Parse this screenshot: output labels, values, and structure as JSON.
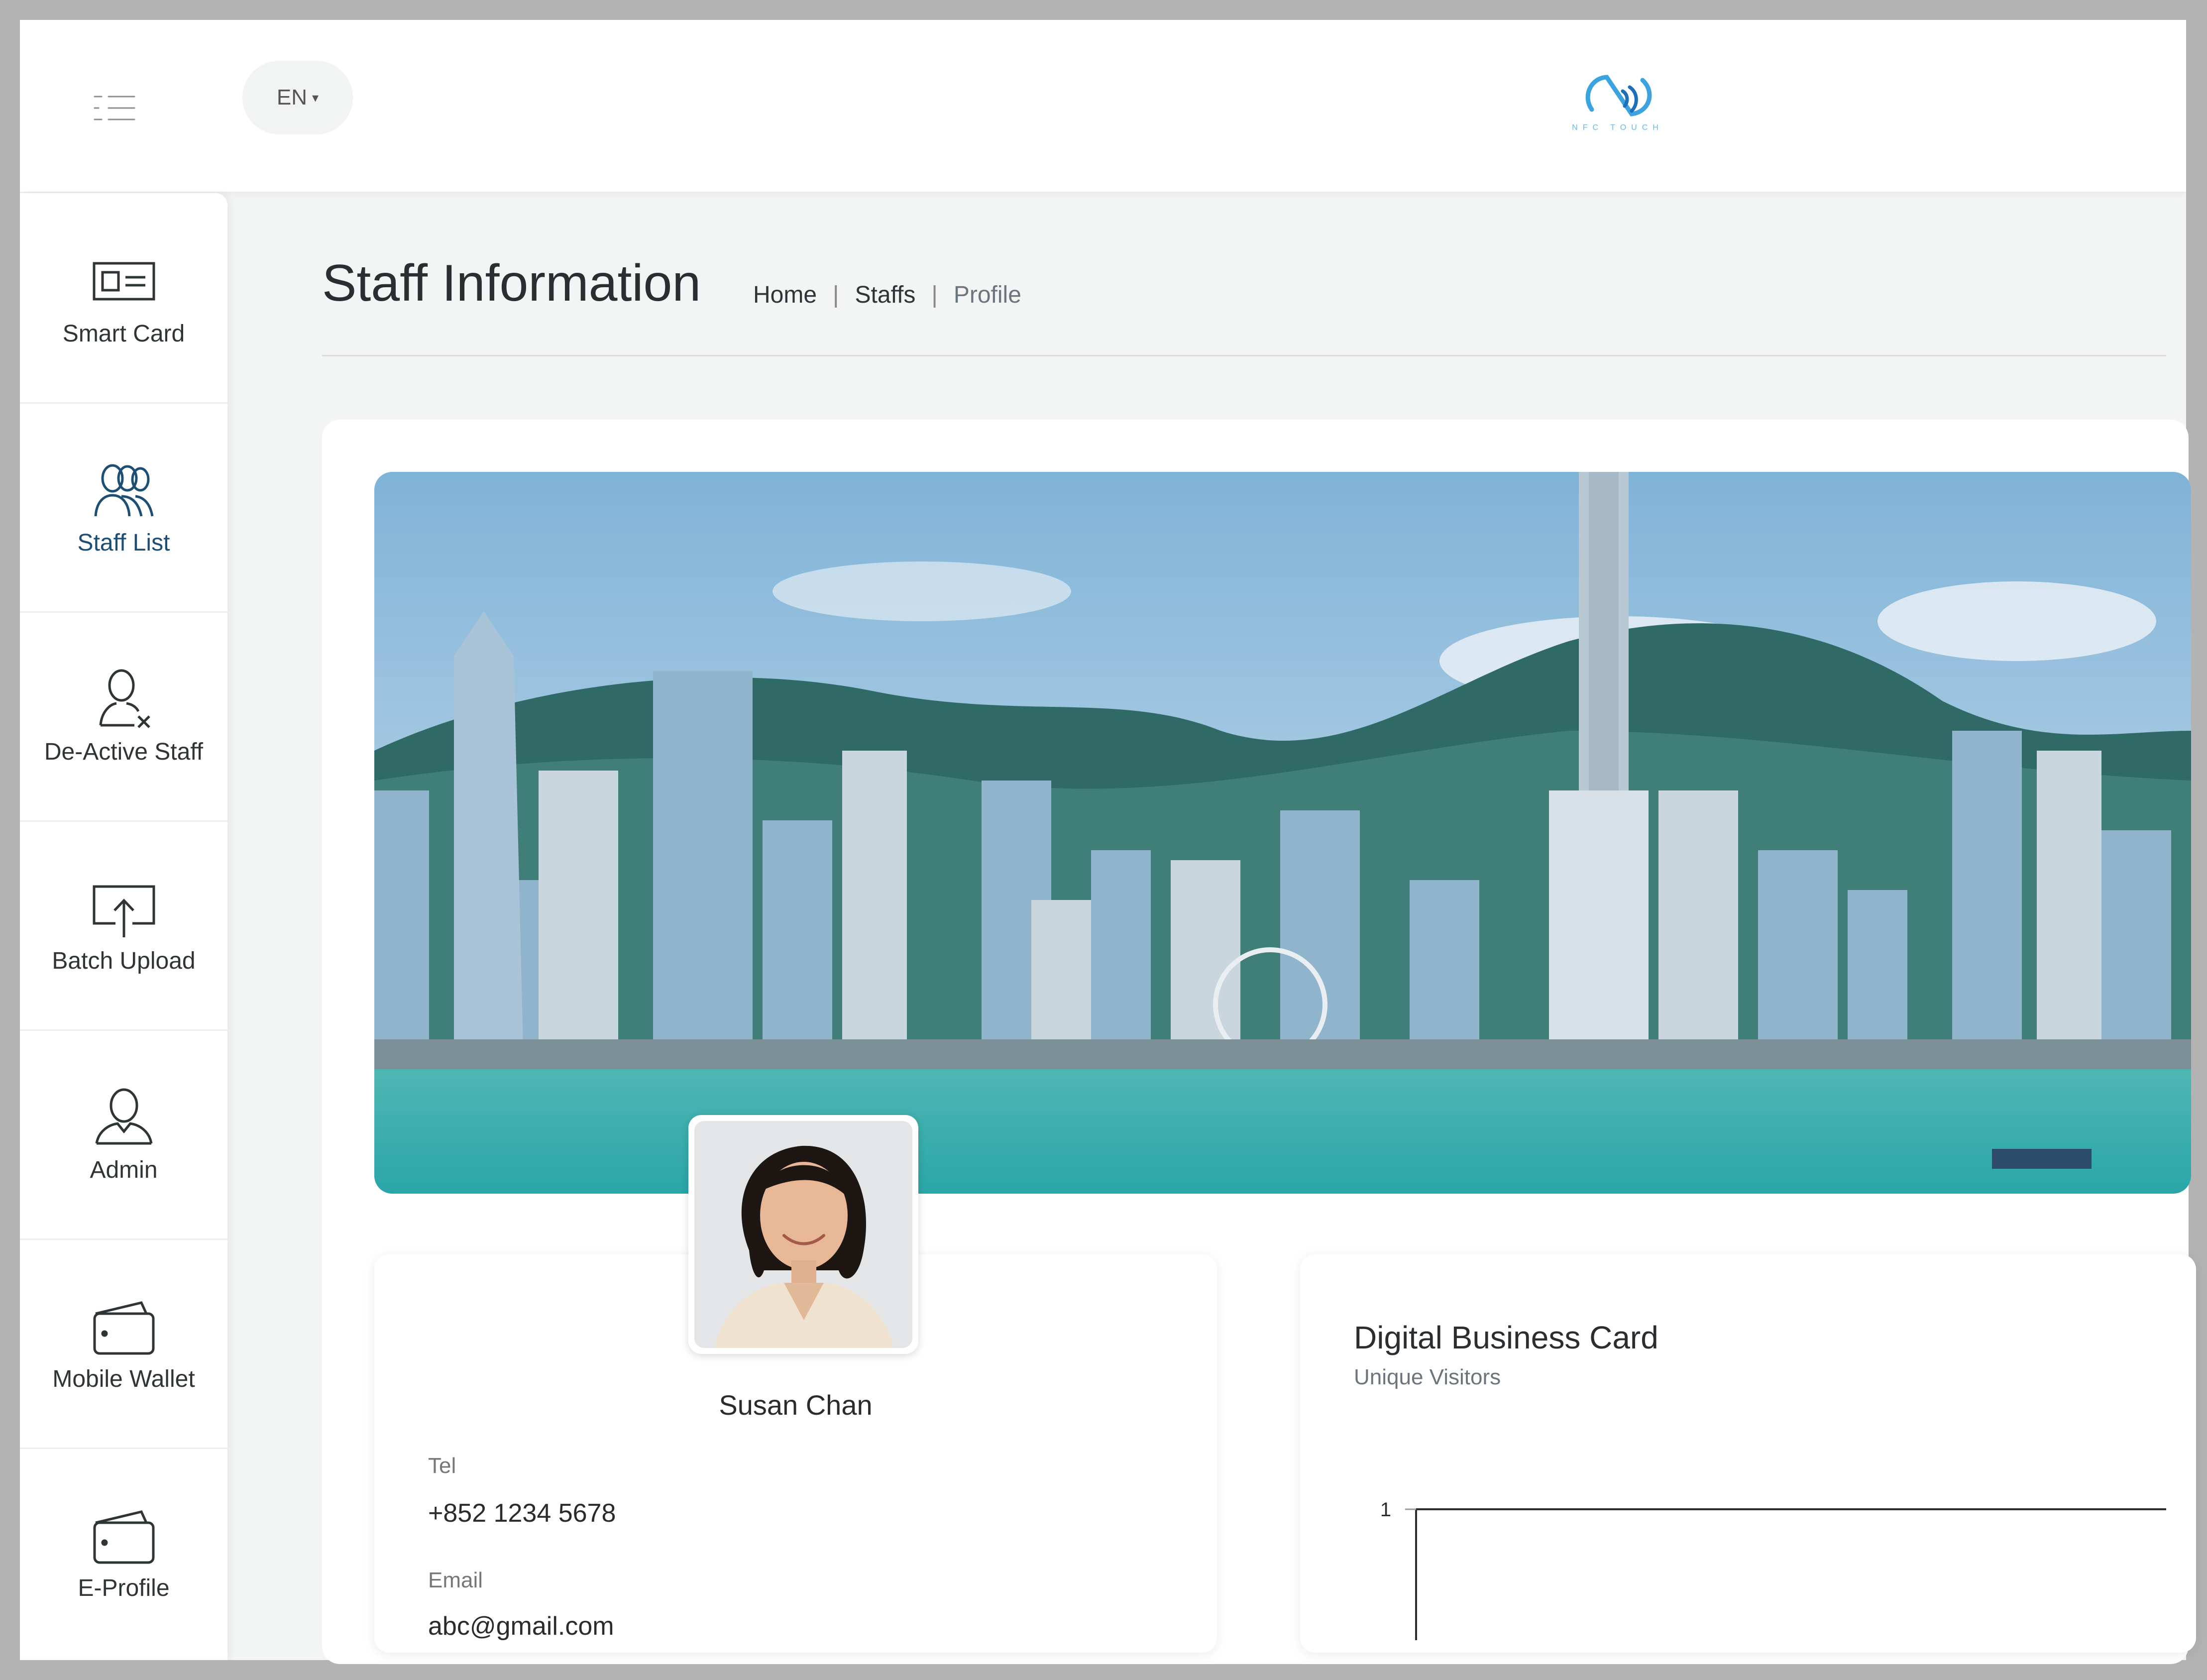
{
  "header": {
    "language": "EN",
    "logo_text": "NFC TOUCH"
  },
  "sidebar": {
    "items": [
      {
        "label": "Smart Card",
        "icon": "id-card-icon"
      },
      {
        "label": "Staff List",
        "icon": "users-group-icon",
        "active": true
      },
      {
        "label": "De-Active Staff",
        "icon": "user-remove-icon"
      },
      {
        "label": "Batch Upload",
        "icon": "upload-screen-icon"
      },
      {
        "label": "Admin",
        "icon": "user-icon"
      },
      {
        "label": "Mobile Wallet",
        "icon": "wallet-icon"
      },
      {
        "label": "E-Profile",
        "icon": "wallet-icon"
      }
    ]
  },
  "page": {
    "title": "Staff Information",
    "breadcrumb": [
      "Home",
      "Staffs",
      "Profile"
    ]
  },
  "profile": {
    "name": "Susan Chan",
    "tel_label": "Tel",
    "tel": "+852 1234 5678",
    "email_label": "Email",
    "email": "abc@gmail.com"
  },
  "card": {
    "title": "Digital Business Card",
    "subtitle": "Unique Visitors"
  },
  "chart_data": {
    "type": "line",
    "title": "Digital Business Card",
    "subtitle": "Unique Visitors",
    "yticks": [
      1
    ],
    "series": [
      {
        "values": [
          1,
          1
        ]
      }
    ]
  },
  "colors": {
    "accent": "#1d4e73",
    "logo": "#3aa3e0",
    "page_bg": "#f3f4f4"
  }
}
